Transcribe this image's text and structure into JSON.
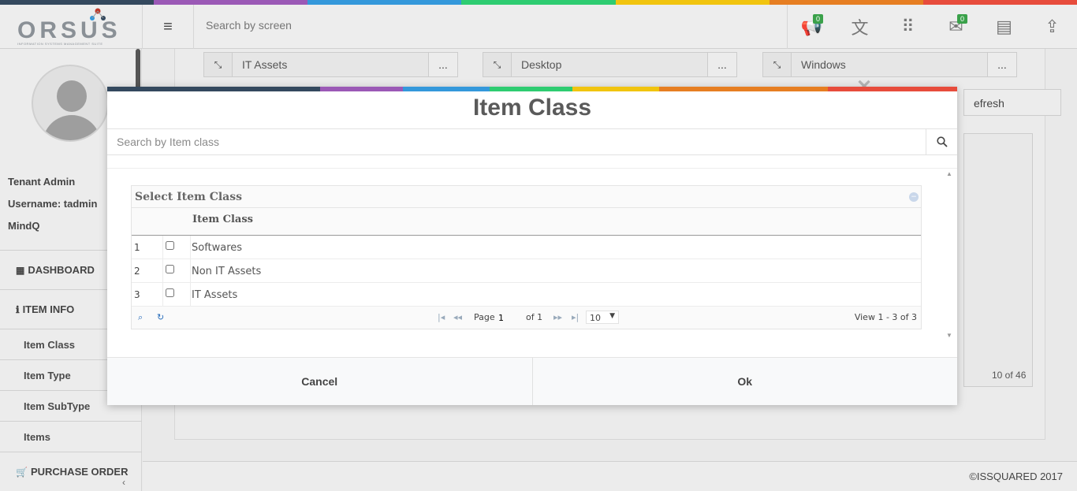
{
  "colors": {
    "strip": [
      "#34495e",
      "#9b59b6",
      "#3498db",
      "#2ecc71",
      "#f1c40f",
      "#e67e22",
      "#e74c3c"
    ],
    "badge": "#3aa14a"
  },
  "header": {
    "logo_text": "ORSUS",
    "logo_subtext": "INFORMATION SYSTEMS MANAGEMENT SUITE",
    "search_placeholder": "Search by screen",
    "icons": [
      {
        "name": "announcements-icon",
        "glyph": "📢",
        "badge": "0"
      },
      {
        "name": "translate-icon",
        "glyph": "文",
        "badge": ""
      },
      {
        "name": "apps-grid-icon",
        "glyph": "⠿",
        "badge": ""
      },
      {
        "name": "mail-icon",
        "glyph": "✉",
        "badge": "0"
      },
      {
        "name": "reports-icon",
        "glyph": "▤",
        "badge": ""
      },
      {
        "name": "upload-icon",
        "glyph": "⇪",
        "badge": ""
      }
    ]
  },
  "sidebar": {
    "role": "Tenant Admin",
    "username": "Username: tadmin",
    "org": "MindQ",
    "items": [
      {
        "label": "DASHBOARD",
        "icon": "▦"
      },
      {
        "label": "ITEM INFO",
        "icon": "ℹ"
      },
      {
        "label": "Item Class"
      },
      {
        "label": "Item Type"
      },
      {
        "label": "Item SubType"
      },
      {
        "label": "Items"
      },
      {
        "label": "PURCHASE ORDER",
        "icon": "🛒"
      }
    ]
  },
  "background": {
    "selectors": [
      {
        "value": "IT Assets",
        "more": "..."
      },
      {
        "value": "Desktop",
        "more": "..."
      },
      {
        "value": "Windows",
        "more": "..."
      }
    ],
    "refresh_label": "efresh",
    "grid_footer": "10 of 46",
    "footer_text": "©ISSQUARED 2017"
  },
  "modal": {
    "close_glyph": "✕",
    "title": "Item Class",
    "search_placeholder": "Search by Item class",
    "grid": {
      "caption": "Select Item Class",
      "column": "Item Class",
      "rows": [
        {
          "num": "1",
          "name": "Softwares",
          "checked": false
        },
        {
          "num": "2",
          "name": "Non IT Assets",
          "checked": false
        },
        {
          "num": "3",
          "name": "IT Assets",
          "checked": false
        }
      ],
      "pager": {
        "page_label": "Page",
        "page_value": "1",
        "of_label": "of 1",
        "page_size": "10",
        "view_text": "View 1 - 3 of 3"
      }
    },
    "cancel_label": "Cancel",
    "ok_label": "Ok"
  }
}
